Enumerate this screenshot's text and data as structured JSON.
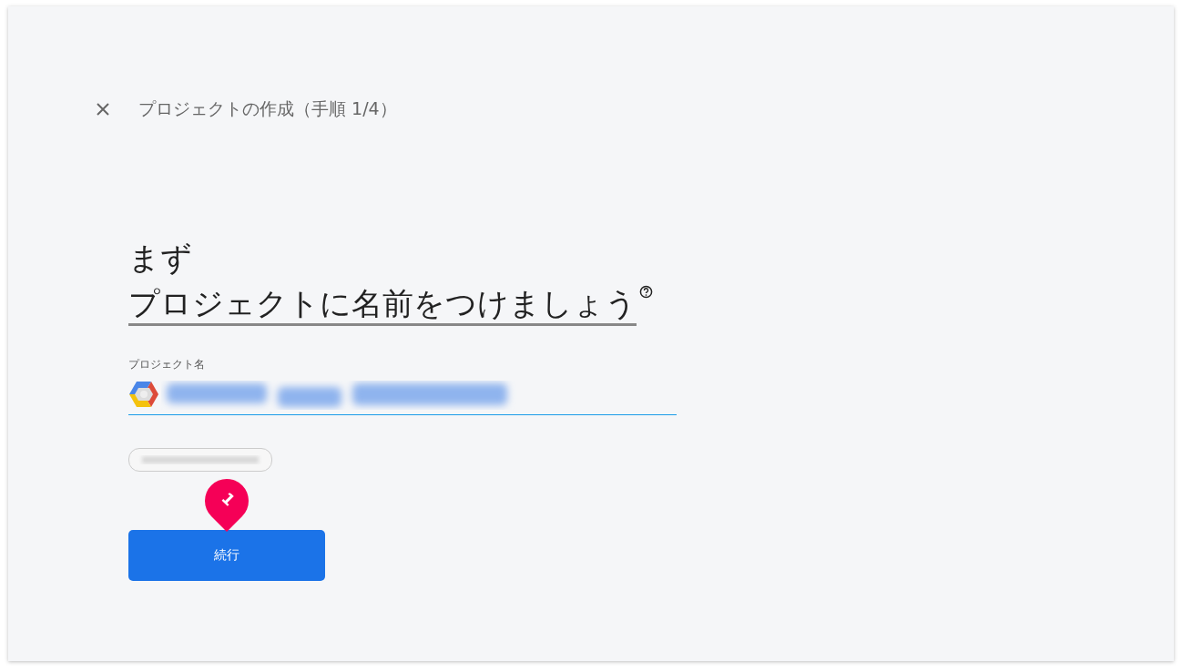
{
  "header": {
    "title": "プロジェクトの作成（手順 1/4）"
  },
  "heading": {
    "lines": [
      "まず",
      "プロジェクトに名前をつけましょう"
    ]
  },
  "field": {
    "label": "プロジェクト名"
  },
  "callout": {
    "number": "1"
  },
  "buttons": [
    {
      "label": "続行",
      "kind": "primary"
    }
  ]
}
